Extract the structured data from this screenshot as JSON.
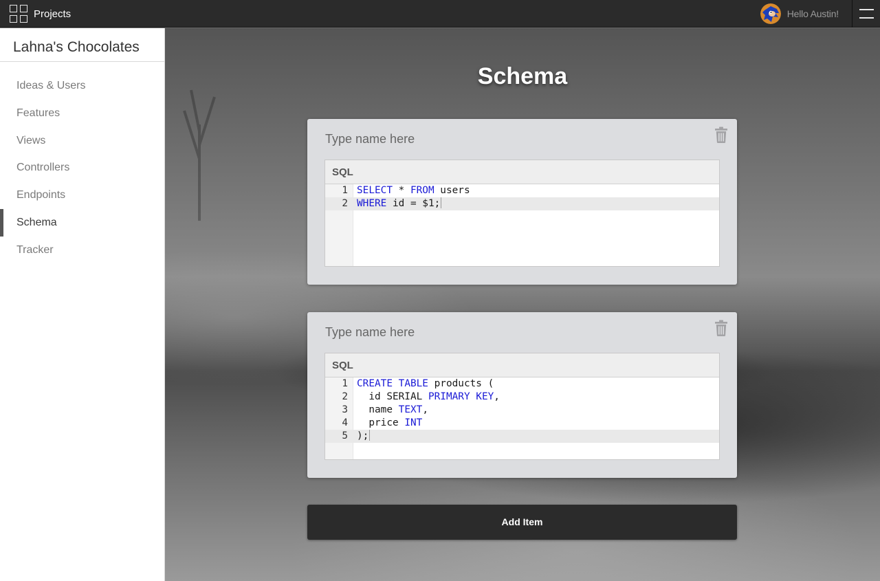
{
  "header": {
    "projects_label": "Projects",
    "projects_icon": "grid-icon",
    "greeting": "Hello Austin!",
    "menu_icon": "hamburger-icon"
  },
  "sidebar": {
    "project_name": "Lahna's Chocolates",
    "items": [
      {
        "label": "Ideas & Users",
        "active": false
      },
      {
        "label": "Features",
        "active": false
      },
      {
        "label": "Views",
        "active": false
      },
      {
        "label": "Controllers",
        "active": false
      },
      {
        "label": "Endpoints",
        "active": false
      },
      {
        "label": "Schema",
        "active": true
      },
      {
        "label": "Tracker",
        "active": false
      }
    ]
  },
  "main": {
    "title": "Schema",
    "cards": [
      {
        "name_placeholder": "Type name here",
        "name_value": "",
        "delete_icon": "trash-icon",
        "language_label": "SQL",
        "line_numbers": [
          "1",
          "2"
        ],
        "code_lines": [
          "SELECT * FROM users",
          "WHERE id = $1;"
        ]
      },
      {
        "name_placeholder": "Type name here",
        "name_value": "",
        "delete_icon": "trash-icon",
        "language_label": "SQL",
        "line_numbers": [
          "1",
          "2",
          "3",
          "4",
          "5"
        ],
        "code_lines": [
          "CREATE TABLE products (",
          "  id SERIAL PRIMARY KEY,",
          "  name TEXT,",
          "  price INT",
          ");"
        ]
      }
    ],
    "add_button_label": "Add Item"
  },
  "colors": {
    "topbar_bg": "#2b2b2b",
    "sql_keyword": "#1a1ad6",
    "active_nav_bar": "#555555",
    "add_button_bg": "#2b2b2b"
  }
}
